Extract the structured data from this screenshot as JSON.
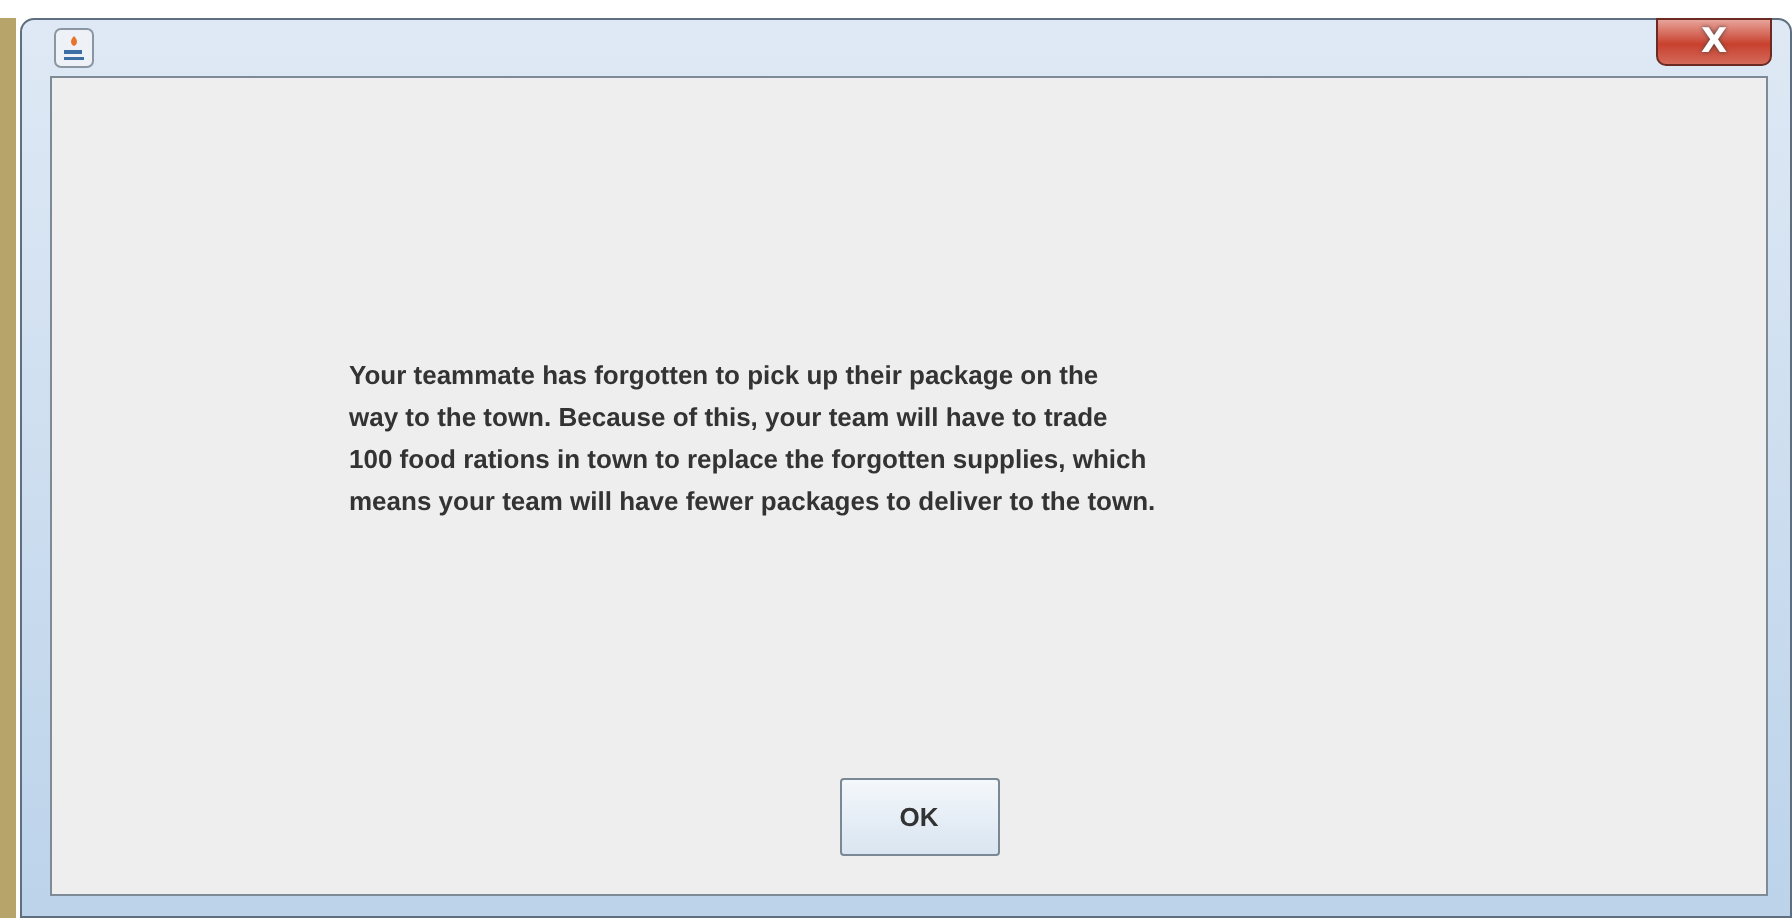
{
  "window": {
    "close_button": "X"
  },
  "message": {
    "lines": [
      "Your teammate has forgotten to pick up their package on the",
      "way to the town. Because of this, your team will have to trade",
      "100 food rations in town to replace the forgotten supplies, which",
      "means your team will have fewer packages to deliver to the town."
    ]
  },
  "buttons": [
    "OK"
  ]
}
